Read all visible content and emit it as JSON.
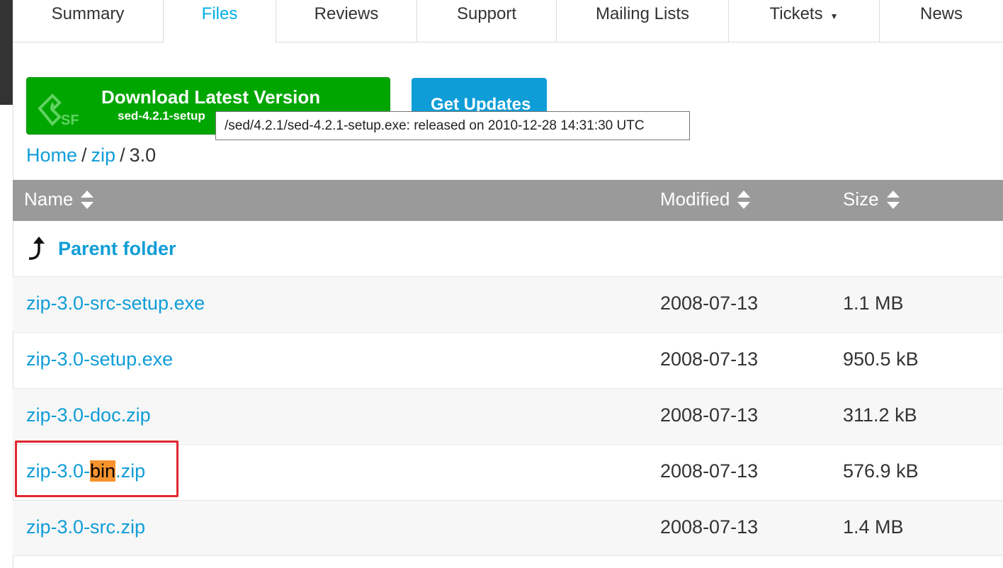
{
  "tabs": [
    {
      "label": "Summary",
      "active": false
    },
    {
      "label": "Files",
      "active": true
    },
    {
      "label": "Reviews",
      "active": false
    },
    {
      "label": "Support",
      "active": false
    },
    {
      "label": "Mailing Lists",
      "active": false
    },
    {
      "label": "Tickets",
      "active": false
    },
    {
      "label": "News",
      "active": false
    }
  ],
  "download": {
    "title": "Download Latest Version",
    "subtitle": "sed-4.2.1-setup",
    "logo_text": "SF"
  },
  "updates": {
    "label": "Get Updates"
  },
  "tooltip": {
    "text": "/sed/4.2.1/sed-4.2.1-setup.exe:  released on 2010-12-28 14:31:30 UTC"
  },
  "breadcrumb": {
    "home": "Home",
    "folder": "zip",
    "current": "3.0",
    "separator": "/"
  },
  "table": {
    "headers": {
      "name": "Name",
      "modified": "Modified",
      "size": "Size"
    },
    "parent": "Parent folder",
    "rows": [
      {
        "name": "zip-3.0-src-setup.exe",
        "modified": "2008-07-13",
        "size": "1.1 MB"
      },
      {
        "name": "zip-3.0-setup.exe",
        "modified": "2008-07-13",
        "size": "950.5 kB"
      },
      {
        "name": "zip-3.0-doc.zip",
        "modified": "2008-07-13",
        "size": "311.2 kB"
      },
      {
        "name_prefix": "zip-3.0-",
        "name_highlight": "bin",
        "name_suffix": ".zip",
        "modified": "2008-07-13",
        "size": "576.9 kB"
      },
      {
        "name": "zip-3.0-src.zip",
        "modified": "2008-07-13",
        "size": "1.4 MB"
      }
    ]
  },
  "colors": {
    "accent": "#0f9dd7",
    "active_tab": "#00aee6",
    "download_green": "#00a600",
    "header_gray": "#9a9a9a",
    "highlight": "#f6932d",
    "annotation_red": "#e1272e"
  }
}
